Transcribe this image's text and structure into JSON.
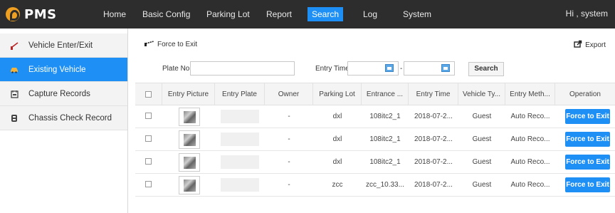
{
  "app": {
    "name": "PMS",
    "greeting": "Hi , system",
    "accent": "#1e90f5",
    "topbar_bg": "#2d2d2d"
  },
  "nav": [
    {
      "label": "Home"
    },
    {
      "label": "Basic Config"
    },
    {
      "label": "Parking Lot"
    },
    {
      "label": "Report"
    },
    {
      "label": "Search",
      "active": true
    },
    {
      "label": "Log"
    },
    {
      "label": "System"
    }
  ],
  "sidebar": {
    "items": [
      {
        "label": "Vehicle Enter/Exit",
        "icon": "barrier-gate-icon"
      },
      {
        "label": "Existing Vehicle",
        "icon": "car-icon",
        "active": true
      },
      {
        "label": "Capture Records",
        "icon": "camera-icon"
      },
      {
        "label": "Chassis Check Record",
        "icon": "chassis-icon"
      }
    ]
  },
  "toolbar": {
    "force_label": "Force to Exit",
    "export_label": "Export"
  },
  "filters": {
    "plate_label": "Plate No. :",
    "plate_value": "",
    "entry_time_label": "Entry Time :",
    "start_time": "",
    "end_time": "",
    "separator": "-",
    "search_label": "Search"
  },
  "table": {
    "columns": [
      "Entry Picture",
      "Entry Plate",
      "Owner",
      "Parking Lot",
      "Entrance ...",
      "Entry Time",
      "Vehicle Ty...",
      "Entry Meth...",
      "Operation"
    ],
    "rows": [
      {
        "plate": "",
        "owner": "-",
        "parking_lot": "dxl",
        "entrance": "108itc2_1",
        "entry_time": "2018-07-2...",
        "vehicle_type": "Guest",
        "entry_method": "Auto Reco...",
        "operation": "Force to Exit"
      },
      {
        "plate": "",
        "owner": "-",
        "parking_lot": "dxl",
        "entrance": "108itc2_1",
        "entry_time": "2018-07-2...",
        "vehicle_type": "Guest",
        "entry_method": "Auto Reco...",
        "operation": "Force to Exit"
      },
      {
        "plate": "",
        "owner": "-",
        "parking_lot": "dxl",
        "entrance": "108itc2_1",
        "entry_time": "2018-07-2...",
        "vehicle_type": "Guest",
        "entry_method": "Auto Reco...",
        "operation": "Force to Exit"
      },
      {
        "plate": "",
        "owner": "-",
        "parking_lot": "zcc",
        "entrance": "zcc_10.33...",
        "entry_time": "2018-07-2...",
        "vehicle_type": "Guest",
        "entry_method": "Auto Reco...",
        "operation": "Force to Exit"
      }
    ]
  }
}
